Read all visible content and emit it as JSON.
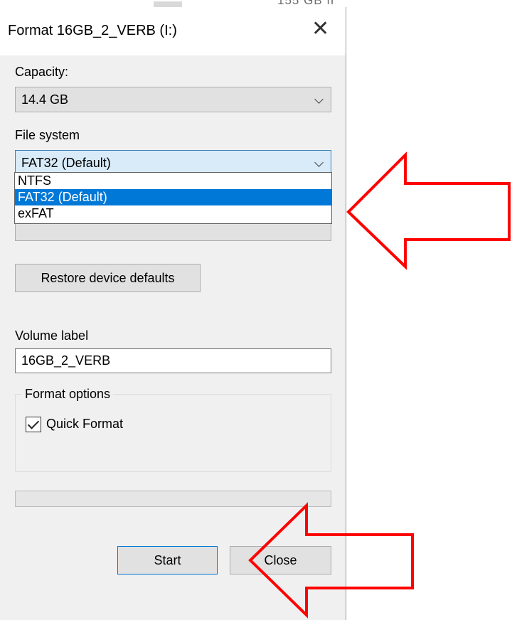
{
  "background": {
    "partial_text": "155 GB fr"
  },
  "dialog": {
    "title": "Format 16GB_2_VERB (I:)",
    "close_glyph": "✕",
    "capacity": {
      "label": "Capacity:",
      "value": "14.4 GB"
    },
    "file_system": {
      "label": "File system",
      "value": "FAT32 (Default)",
      "options": [
        "NTFS",
        "FAT32 (Default)",
        "exFAT"
      ],
      "selected_index": 1
    },
    "restore_label": "Restore device defaults",
    "volume_label": {
      "label": "Volume label",
      "value": "16GB_2_VERB"
    },
    "format_options": {
      "legend": "Format options",
      "quick_format_label": "Quick Format",
      "quick_format_checked": true
    },
    "progress": 0,
    "start_label": "Start",
    "close_label": "Close"
  },
  "colors": {
    "accent": "#0078d7",
    "annotation": "#ff0000",
    "dialog_bg": "#f0f0f0"
  },
  "icons": [
    "chevron-down-icon",
    "close-icon",
    "checkmark-icon",
    "arrow-left-icon"
  ]
}
